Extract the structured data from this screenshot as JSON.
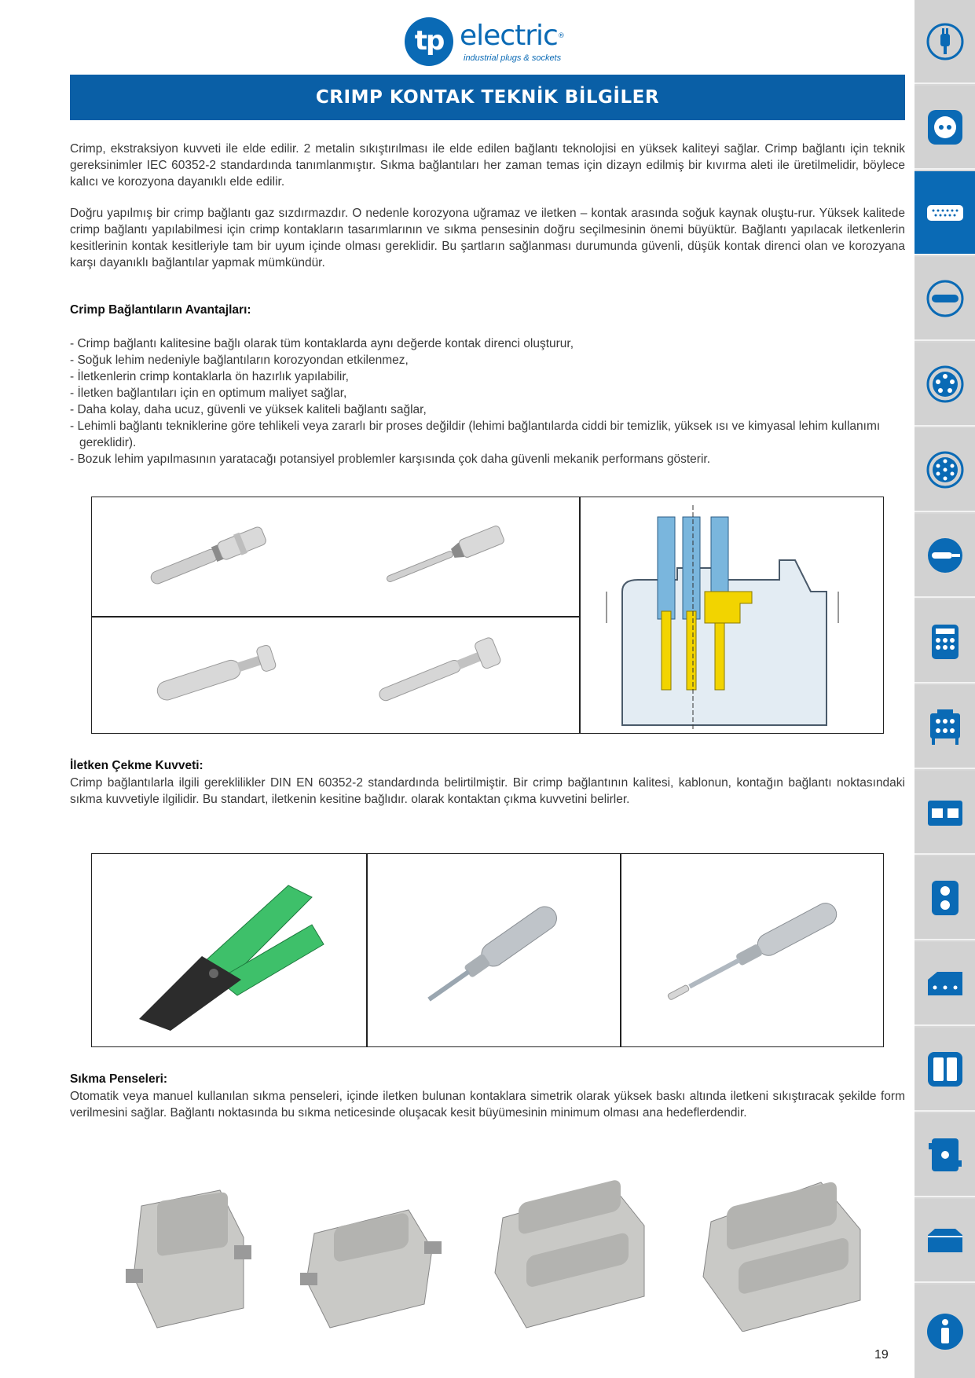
{
  "logo": {
    "mark": "tp",
    "word": "electric",
    "reg": "®",
    "tagline": "industrial plugs & sockets"
  },
  "title": "CRIMP KONTAK TEKNİK BİLGİLER",
  "paragraphs": {
    "p1": "Crimp, ekstraksiyon kuvveti ile elde edilir. 2 metalin sıkıştırılması ile elde edilen bağlantı teknolojisi en yüksek kaliteyi sağlar. Crimp bağlantı için teknik gereksinimler IEC 60352-2 standardında tanımlanmıştır. Sıkma bağlantıları her zaman temas için dizayn edilmiş bir kıvırma aleti ile üretilmelidir, böylece kalıcı ve korozyona dayanıklı elde edilir.",
    "p2": "Doğru yapılmış bir crimp bağlantı gaz sızdırmazdır. O nedenle korozyona uğramaz ve iletken – kontak arasında soğuk kaynak oluştu-rur. Yüksek kalitede crimp bağlantı yapılabilmesi için crimp kontakların tasarımlarının ve sıkma pensesinin doğru seçilmesinin önemi büyüktür. Bağlantı yapılacak iletkenlerin kesitlerinin kontak kesitleriyle tam bir uyum içinde olması gereklidir. Bu şartların sağlanması durumunda güvenli, düşük kontak direnci olan ve korozyana karşı dayanıklı bağlantılar yapmak mümkündür."
  },
  "advantages": {
    "heading": "Crimp Bağlantıların Avantajları:",
    "items": [
      "Crimp bağlantı kalitesine bağlı olarak tüm kontaklarda aynı değerde kontak direnci oluşturur,",
      "Soğuk lehim nedeniyle bağlantıların korozyondan etkilenmez,",
      "İletkenlerin crimp kontaklarla ön hazırlık yapılabilir,",
      "İletken bağlantıları için en optimum maliyet sağlar,",
      "Daha kolay, daha ucuz, güvenli ve yüksek kaliteli bağlantı sağlar,",
      "Lehimli bağlantı tekniklerine göre tehlikeli veya zararlı bir proses değildir (lehimi bağlantılarda ciddi bir temizlik, yüksek ısı ve kimyasal lehim kullanımı gereklidir).",
      "Bozuk lehim yapılmasının yaratacağı potansiyel problemler karşısında çok daha güvenli mekanik performans gösterir."
    ]
  },
  "force": {
    "heading": "İletken Çekme Kuvveti:",
    "text": "Crimp bağlantılarla ilgili gereklilikler DIN EN 60352-2 standardında belirtilmiştir. Bir crimp bağlantının kalitesi, kablonun, kontağın bağlantı noktasındaki sıkma kuvvetiyle ilgilidir. Bu standart, iletkenin kesitine bağlıdır. olarak kontaktan çıkma kuvvetini belirler."
  },
  "press": {
    "heading": "Sıkma Penseleri:",
    "text": "Otomatik veya manuel kullanılan sıkma penseleri, içinde iletken bulunan kontaklara simetrik olarak yüksek baskı altında iletkeni sıkıştıracak şekilde form verilmesini sağlar. Bağlantı noktasında bu sıkma neticesinde oluşacak kesit büyümesinin minimum olması ana hedeflerdendir."
  },
  "page_number": "19",
  "colors": {
    "brand_blue": "#0a6ab5",
    "band_blue": "#0a5fa6",
    "sidebar_gray": "#d2d2d2",
    "crimp_yellow": "#f2d400",
    "plier_green": "#3ec06a"
  },
  "sidebar": {
    "active_index": 2,
    "icons": [
      "plug-icon",
      "socket-icon",
      "multipin-connector-icon",
      "cee-connector-icon",
      "round-5pin-icon",
      "round-7pin-icon",
      "inline-plug-icon",
      "distribution-board-icon",
      "portable-box-icon",
      "enclosure-icon",
      "wall-box-icon",
      "junction-box-icon",
      "double-panel-icon",
      "cable-box-icon",
      "housing-icon",
      "info-icon"
    ]
  }
}
